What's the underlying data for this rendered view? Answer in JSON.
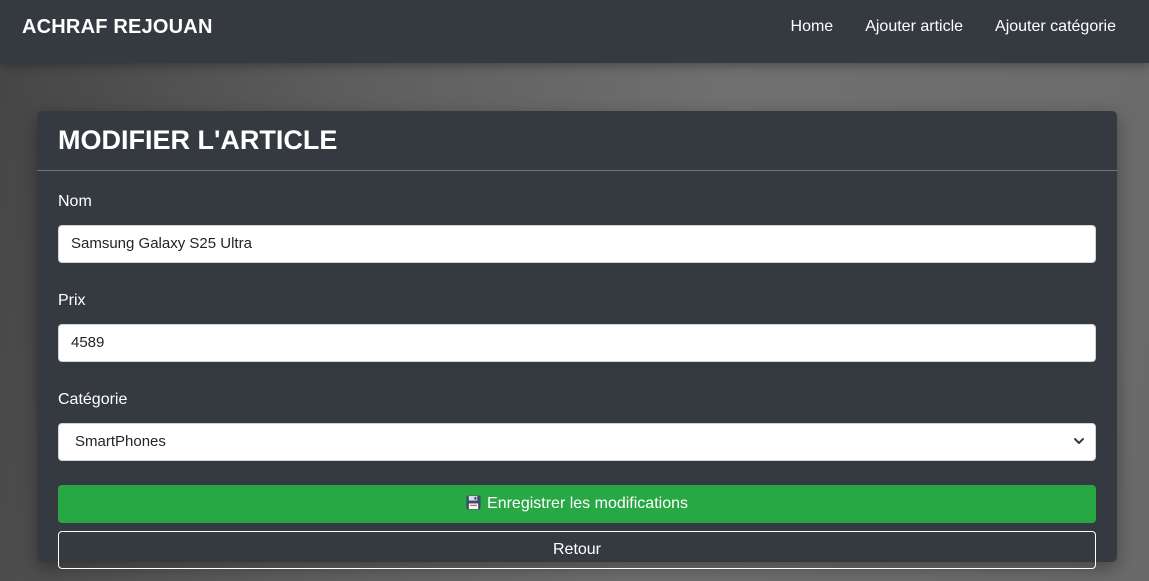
{
  "navbar": {
    "brand": "ACHRAF REJOUAN",
    "links": [
      "Home",
      "Ajouter article",
      "Ajouter catégorie"
    ]
  },
  "card": {
    "title": "MODIFIER L'ARTICLE",
    "fields": {
      "nom": {
        "label": "Nom",
        "value": "Samsung Galaxy S25 Ultra"
      },
      "prix": {
        "label": "Prix",
        "value": "4589"
      },
      "categorie": {
        "label": "Catégorie",
        "selected": "SmartPhones"
      }
    },
    "buttons": {
      "save_icon": "floppy-disk-icon",
      "save_label": "Enregistrer les modifications",
      "back_label": "Retour"
    }
  },
  "colors": {
    "navbar_bg": "#343a40",
    "card_bg": "#343a40",
    "save_button": "#28a745"
  }
}
